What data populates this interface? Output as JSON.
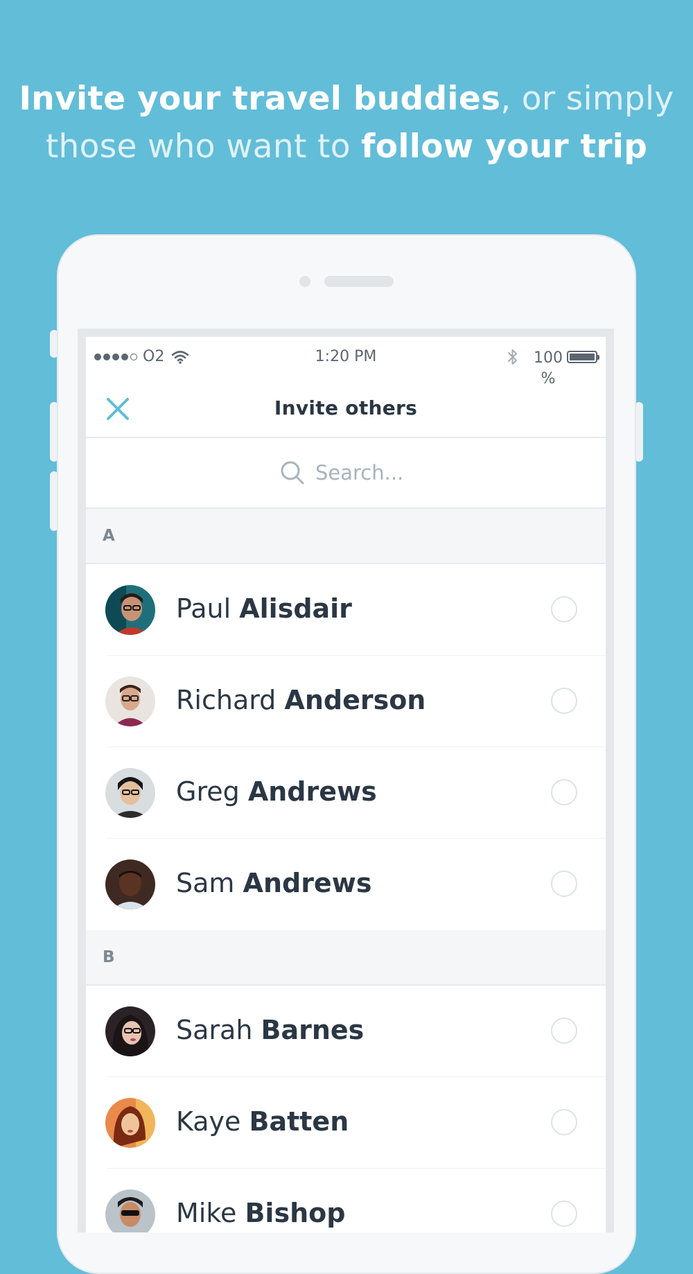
{
  "headline": {
    "line1_bold": "Invite your travel buddies",
    "line1_light": ", or simply",
    "line2_light": "those who want to ",
    "line2_bold": "follow your trip"
  },
  "status_bar": {
    "carrier": "O2",
    "time": "1:20 PM",
    "battery_text": "100\n%",
    "battery_level": 1.0,
    "signal_strength": "4 of 5"
  },
  "nav": {
    "title": "Invite others",
    "close_icon": "close-icon",
    "accent_color": "#5fbdd6"
  },
  "search": {
    "placeholder": "Search...",
    "value": ""
  },
  "sections": [
    {
      "letter": "A",
      "contacts": [
        {
          "first": "Paul",
          "last": "Alisdair",
          "avatar": "avatar-photo"
        },
        {
          "first": "Richard",
          "last": "Anderson",
          "avatar": "avatar-photo"
        },
        {
          "first": "Greg",
          "last": "Andrews",
          "avatar": "avatar-photo"
        },
        {
          "first": "Sam",
          "last": "Andrews",
          "avatar": "avatar-photo"
        }
      ]
    },
    {
      "letter": "B",
      "contacts": [
        {
          "first": "Sarah",
          "last": "Barnes",
          "avatar": "avatar-photo"
        },
        {
          "first": "Kaye",
          "last": "Batten",
          "avatar": "avatar-photo"
        },
        {
          "first": "Mike",
          "last": "Bishop",
          "avatar": "avatar-photo"
        }
      ]
    }
  ],
  "colors": {
    "background": "#62bdd8",
    "text_dark": "#2b3744",
    "section_bg": "#f5f6f8"
  }
}
